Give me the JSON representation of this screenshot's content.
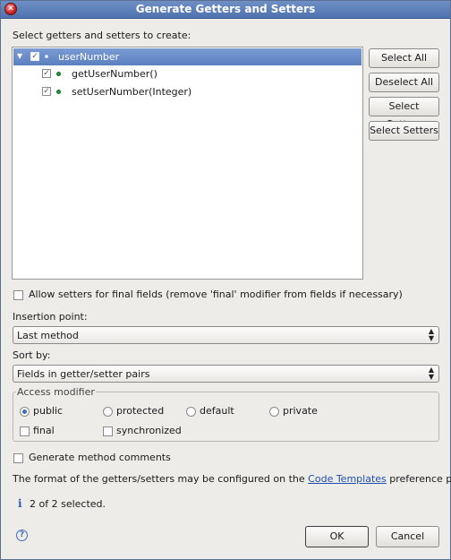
{
  "window": {
    "title": "Generate Getters and Setters"
  },
  "tree": {
    "heading": "Select getters and setters to create:",
    "field": "userNumber",
    "methods": [
      "getUserNumber()",
      "setUserNumber(Integer)"
    ]
  },
  "side_buttons": {
    "select_all": "Select All",
    "deselect_all": "Deselect All",
    "select_getters": "Select Getters",
    "select_setters": "Select Setters"
  },
  "allow_setters": "Allow setters for final fields (remove 'final' modifier from fields if necessary)",
  "insertion": {
    "label": "Insertion point:",
    "value": "Last method"
  },
  "sort": {
    "label": "Sort by:",
    "value": "Fields in getter/setter pairs"
  },
  "access": {
    "legend": "Access modifier",
    "options": [
      "public",
      "protected",
      "default",
      "private"
    ],
    "selected": "public",
    "final": "final",
    "synchronized": "synchronized"
  },
  "generate_comments": "Generate method comments",
  "info": {
    "prefix": "The format of the getters/setters may be configured on the",
    "link": "Code Templates",
    "suffix": "preference page."
  },
  "status": "2 of 2 selected.",
  "footer": {
    "ok": "OK",
    "cancel": "Cancel"
  },
  "colors": {
    "selection": "#5c80c0",
    "link": "#1f4fae",
    "titlebar": "#4f73b1"
  }
}
